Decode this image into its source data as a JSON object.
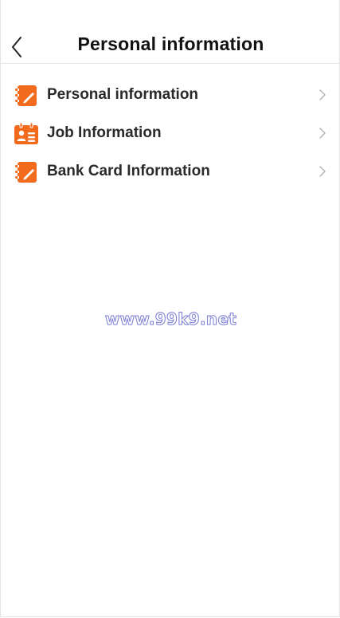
{
  "header": {
    "title": "Personal information",
    "back_icon": "chevron-left-icon"
  },
  "menu": {
    "items": [
      {
        "label": "Personal information",
        "icon": "edit-document-icon"
      },
      {
        "label": "Job Information",
        "icon": "id-badge-icon"
      },
      {
        "label": "Bank Card Information",
        "icon": "edit-document-icon"
      }
    ],
    "chevron_icon": "chevron-right-icon"
  },
  "watermark": {
    "text": "www.99k9.net"
  },
  "colors": {
    "accent": "#f26b1d",
    "divider": "#e6e6e6",
    "chevron": "#b5b5b5",
    "watermark_outline": "#7b7fd6"
  }
}
